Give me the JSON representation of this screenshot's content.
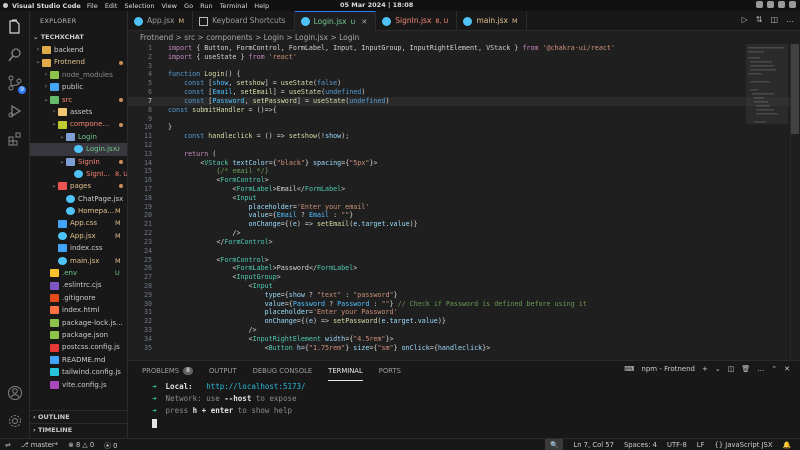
{
  "system": {
    "app_name": "Visual Studio Code",
    "menu": [
      "File",
      "Edit",
      "Selection",
      "View",
      "Go",
      "Run",
      "Terminal",
      "Help"
    ],
    "clock": "05 Mar 2024 | 18:08"
  },
  "activity": {
    "source_control_badge": "9"
  },
  "sidebar": {
    "title": "EXPLORER",
    "root": "TECHXCHAT",
    "items": [
      {
        "label": "backend",
        "status": ""
      },
      {
        "label": "Frotnend",
        "status": ""
      },
      {
        "label": "node_modules",
        "status": ""
      },
      {
        "label": "public",
        "status": ""
      },
      {
        "label": "src",
        "status": ""
      },
      {
        "label": "assets",
        "status": ""
      },
      {
        "label": "compone...",
        "status": ""
      },
      {
        "label": "Login",
        "status": ""
      },
      {
        "label": "Login.jsx",
        "status": "U"
      },
      {
        "label": "SignIn",
        "status": ""
      },
      {
        "label": "SignI...",
        "status": "8, U"
      },
      {
        "label": "pages",
        "status": ""
      },
      {
        "label": "ChatPage.jsx",
        "status": ""
      },
      {
        "label": "Homepa...",
        "status": "M"
      },
      {
        "label": "App.css",
        "status": "M"
      },
      {
        "label": "App.jsx",
        "status": "M"
      },
      {
        "label": "index.css",
        "status": ""
      },
      {
        "label": "main.jsx",
        "status": "M"
      },
      {
        "label": ".env",
        "status": "U"
      },
      {
        "label": ".eslintrc.cjs",
        "status": ""
      },
      {
        "label": ".gitignore",
        "status": ""
      },
      {
        "label": "index.html",
        "status": ""
      },
      {
        "label": "package-lock.js...",
        "status": ""
      },
      {
        "label": "package.json",
        "status": ""
      },
      {
        "label": "postcss.config.js",
        "status": ""
      },
      {
        "label": "README.md",
        "status": ""
      },
      {
        "label": "tailwind.config.js",
        "status": ""
      },
      {
        "label": "vite.config.js",
        "status": ""
      }
    ],
    "outline": "OUTLINE",
    "timeline": "TIMELINE"
  },
  "tabs": [
    {
      "label": "App.jsx",
      "mark": "M"
    },
    {
      "label": "Keyboard Shortcuts",
      "mark": ""
    },
    {
      "label": "Login.jsx",
      "mark": "U"
    },
    {
      "label": "SignIn.jsx",
      "mark": "8, U"
    },
    {
      "label": "main.jsx",
      "mark": "M"
    }
  ],
  "breadcrumb": {
    "parts": [
      "Frotnend",
      "src",
      "components",
      "Login",
      "Login.jsx",
      "Login"
    ],
    "separator": ">"
  },
  "editor": {
    "current_line": 7,
    "line_numbers": [
      "1",
      "2",
      "3",
      "4",
      "5",
      "6",
      "7",
      "8",
      "9",
      "10",
      "11",
      "12",
      "13",
      "14",
      "15",
      "16",
      "17",
      "18",
      "19",
      "20",
      "21",
      "22",
      "23",
      "24",
      "25",
      "26",
      "27",
      "28",
      "29",
      "30",
      "31",
      "32",
      "33",
      "34",
      "35"
    ]
  },
  "panel": {
    "tabs": [
      "PROBLEMS",
      "OUTPUT",
      "DEBUG CONSOLE",
      "TERMINAL",
      "PORTS"
    ],
    "problems_count": "8",
    "terminal_name": "npm - Frotnend",
    "terminal": {
      "local_label": "Local:",
      "local_url": "http://localhost:5173/",
      "network_label": "Network:",
      "network_text": "use",
      "network_flag": "--host",
      "network_tail": "to expose",
      "help_pre": "press",
      "help_key": "h + enter",
      "help_tail": "to show help"
    }
  },
  "status": {
    "branch": "master*",
    "errors": "8",
    "warnings": "0",
    "ports": "0",
    "position": "Ln 7, Col 57",
    "spaces": "Spaces: 4",
    "encoding": "UTF-8",
    "eol": "LF",
    "language": "{} JavaScript JSX"
  },
  "colors": {
    "accent": "#2f7df6",
    "modified": "#e2c08d",
    "untracked": "#73c991",
    "error": "#f48771"
  }
}
